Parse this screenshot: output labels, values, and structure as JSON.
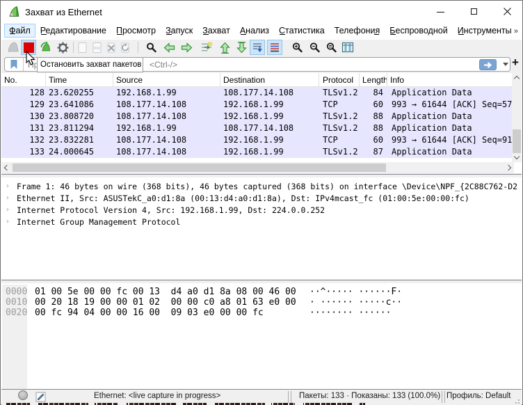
{
  "window": {
    "title": "Захват из Ethernet"
  },
  "menu": {
    "items": [
      {
        "label": "Файл",
        "mn": "first",
        "hover": true
      },
      {
        "label": "Редактирование",
        "mn": "first"
      },
      {
        "label": "Просмотр",
        "mn": "first"
      },
      {
        "label": "Запуск",
        "mn": "first"
      },
      {
        "label": "Захват",
        "mn": "first"
      },
      {
        "label": "Анализ",
        "mn": "first"
      },
      {
        "label": "Статистика",
        "mn": "first"
      },
      {
        "label": "Телефония",
        "mn": "last"
      },
      {
        "label": "Беспроводной",
        "mn": "first"
      },
      {
        "label": "Инструменты",
        "mn": "first"
      }
    ],
    "overflow": "»"
  },
  "toolbar": {
    "tooltip": "Остановить захват пакетов"
  },
  "filter": {
    "placeholder_start": "При",
    "placeholder_end": "<Ctrl-/>",
    "plus": "+"
  },
  "packet_list": {
    "columns": [
      "No.",
      "Time",
      "Source",
      "Destination",
      "Protocol",
      "Length",
      "Info"
    ],
    "rows": [
      [
        "128",
        "23.620255",
        "192.168.1.99",
        "108.177.14.108",
        "TLSv1.2",
        "84",
        "Application Data"
      ],
      [
        "129",
        "23.641086",
        "108.177.14.108",
        "192.168.1.99",
        "TCP",
        "60",
        "993 → 61644 [ACK] Seq=57"
      ],
      [
        "130",
        "23.808720",
        "108.177.14.108",
        "192.168.1.99",
        "TLSv1.2",
        "88",
        "Application Data"
      ],
      [
        "131",
        "23.811294",
        "192.168.1.99",
        "108.177.14.108",
        "TLSv1.2",
        "88",
        "Application Data"
      ],
      [
        "132",
        "23.832281",
        "108.177.14.108",
        "192.168.1.99",
        "TCP",
        "60",
        "993 → 61644 [ACK] Seq=91"
      ],
      [
        "133",
        "24.000645",
        "108.177.14.108",
        "192.168.1.99",
        "TLSv1.2",
        "87",
        "Application Data"
      ]
    ]
  },
  "details": {
    "lines": [
      "Frame 1: 46 bytes on wire (368 bits), 46 bytes captured (368 bits) on interface \\Device\\NPF_{2C88C762-D2",
      "Ethernet II, Src: ASUSTekC_a0:d1:8a (00:13:d4:a0:d1:8a), Dst: IPv4mcast_fc (01:00:5e:00:00:fc)",
      "Internet Protocol Version 4, Src: 192.168.1.99, Dst: 224.0.0.252",
      "Internet Group Management Protocol"
    ]
  },
  "hex": {
    "rows": [
      {
        "offset": "0000",
        "bytes": "01 00 5e 00 00 fc 00 13  d4 a0 d1 8a 08 00 46 00",
        "ascii": "··^····· ······F·"
      },
      {
        "offset": "0010",
        "bytes": "00 20 18 19 00 00 01 02  00 00 c0 a8 01 63 e0 00",
        "ascii": "· ······ ·····c··"
      },
      {
        "offset": "0020",
        "bytes": "00 fc 94 04 00 00 16 00  09 03 e0 00 00 fc",
        "ascii": "········ ······"
      }
    ]
  },
  "status": {
    "capture": "Ethernet: <live capture in progress>",
    "packets": "Пакеты: 133 · Показаны: 133 (100.0%)",
    "profile": "Профиль: Default"
  }
}
